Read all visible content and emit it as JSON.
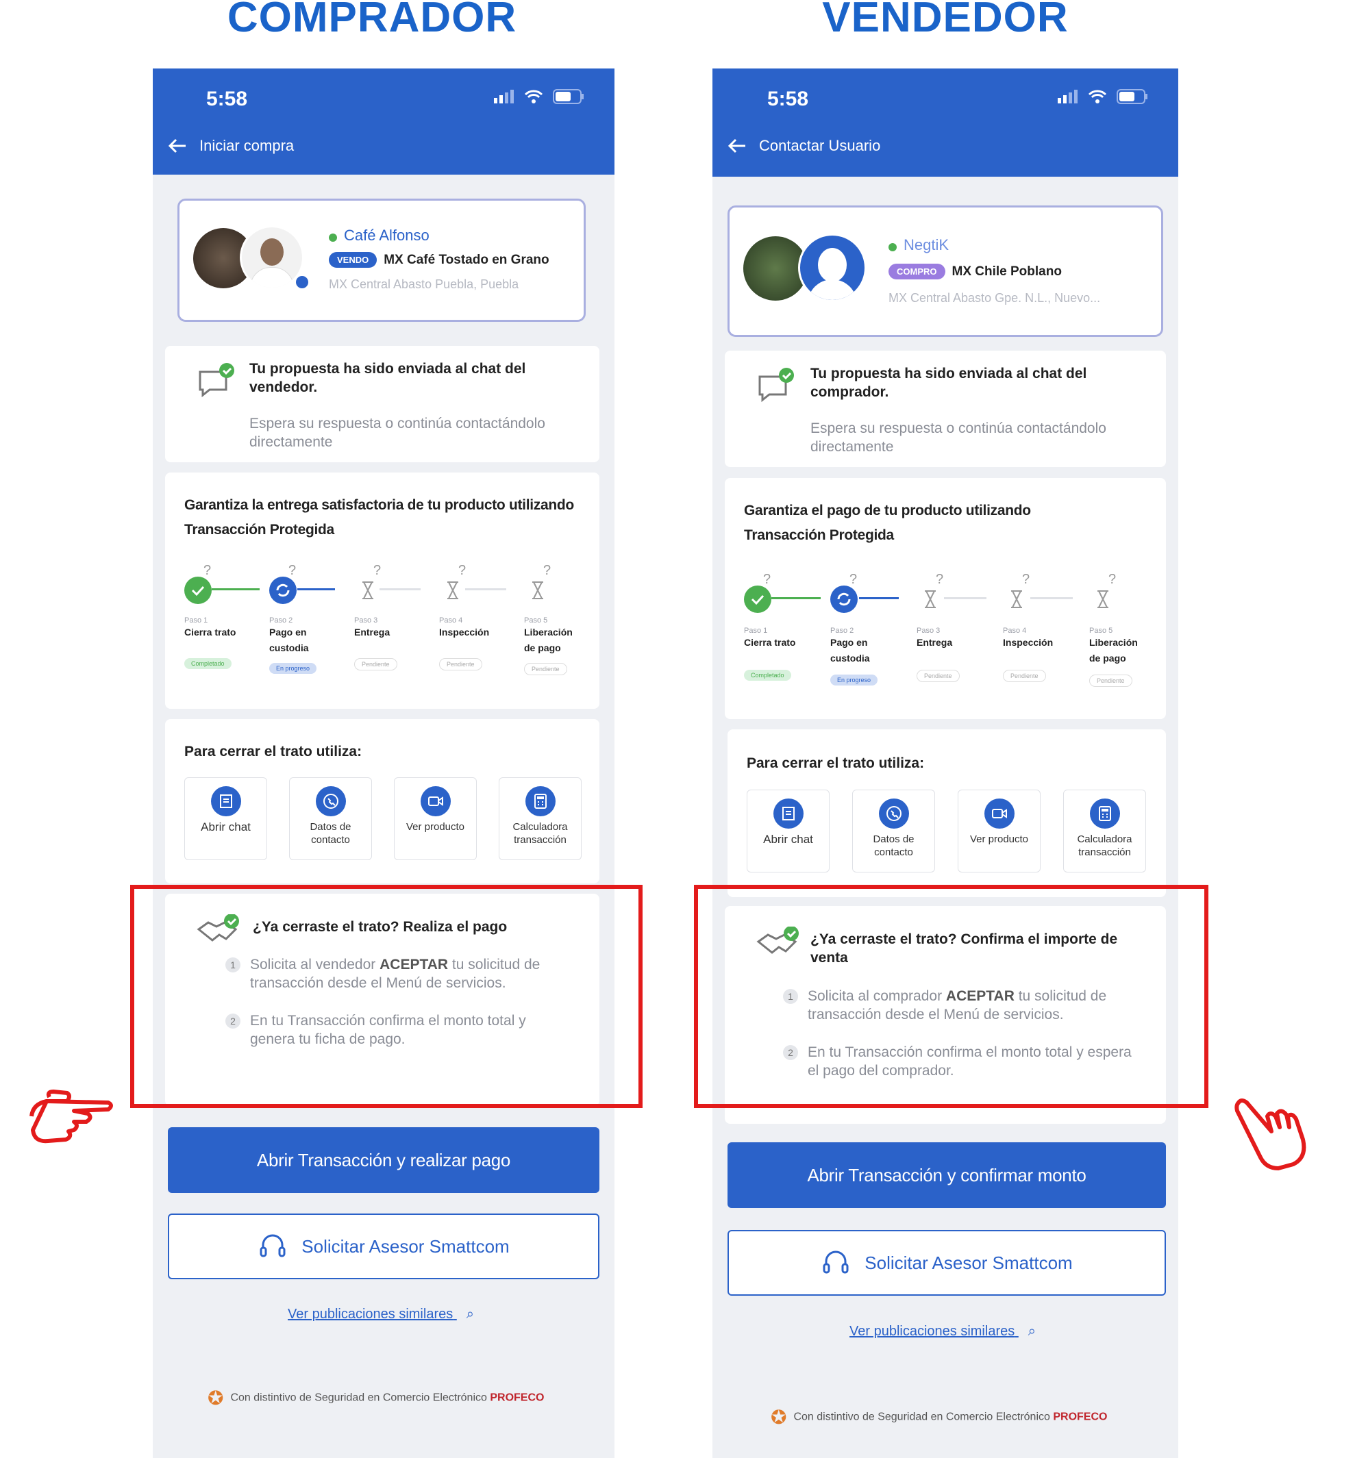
{
  "buyer": {
    "heading": "COMPRADOR",
    "time": "5:58",
    "nav_title": "Iniciar compra",
    "seller_name": "Café Alfonso",
    "badge": "VENDO",
    "product": "MX Café Tostado en Grano",
    "location": "MX Central Abasto Puebla, Puebla",
    "msg_title": "Tu propuesta ha sido enviada al chat del vendedor.",
    "msg_sub": "Espera su respuesta o continúa contactándolo directamente",
    "guarantee_title": "Garantiza la entrega satisfactoria de tu producto utilizando Transacción Protegida",
    "close_title": "¿Ya cerraste el trato? Realiza el pago",
    "close_step1_pre": "Solicita al vendedor ",
    "close_step1_bold": "ACEPTAR",
    "close_step1_post": " tu solicitud de transacción desde el Menú de servicios.",
    "close_step2": "En tu Transacción confirma el monto total y genera tu ficha de pago.",
    "cta": "Abrir Transacción y realizar pago"
  },
  "seller": {
    "heading": "VENDEDOR",
    "time": "5:58",
    "nav_title": "Contactar Usuario",
    "seller_name": "NegtiK",
    "badge": "COMPRO",
    "product": "MX Chile Poblano",
    "location": "MX Central Abasto Gpe. N.L., Nuevo...",
    "msg_title": "Tu propuesta ha sido enviada al chat del comprador.",
    "msg_sub": "Espera su respuesta o continúa contactándolo directamente",
    "guarantee_title": "Garantiza el pago de tu producto utilizando Transacción Protegida",
    "close_title": "¿Ya cerraste el trato? Confirma el importe de venta",
    "close_step1_pre": "Solicita al comprador ",
    "close_step1_bold": "ACEPTAR",
    "close_step1_post": " tu solicitud de transacción desde el Menú de servicios.",
    "close_step2": "En tu Transacción confirma el monto total y espera el pago del comprador.",
    "cta": "Abrir Transacción y confirmar monto"
  },
  "steps": [
    {
      "num": "Paso 1",
      "name": "Cierra trato",
      "status": "Completado"
    },
    {
      "num": "Paso 2",
      "name": "Pago en custodia",
      "status": "En progreso"
    },
    {
      "num": "Paso 3",
      "name": "Entrega",
      "status": "Pendiente"
    },
    {
      "num": "Paso 4",
      "name": "Inspección",
      "status": "Pendiente"
    },
    {
      "num": "Paso 5",
      "name": "Liberación de pago",
      "status": "Pendiente"
    }
  ],
  "tools_title": "Para cerrar el trato utiliza:",
  "tools": [
    "Abrir chat",
    "Datos de contacto",
    "Ver producto",
    "Calculadora transacción"
  ],
  "advisor": "Solicitar Asesor Smattcom",
  "similar": "Ver publicaciones similares",
  "footer_text": "Con distintivo de Seguridad en Comercio Electrónico ",
  "footer_brand": "PROFECO",
  "colors": {
    "primary": "#2b62c9",
    "red": "#e31b1b",
    "green": "#4caf50"
  }
}
